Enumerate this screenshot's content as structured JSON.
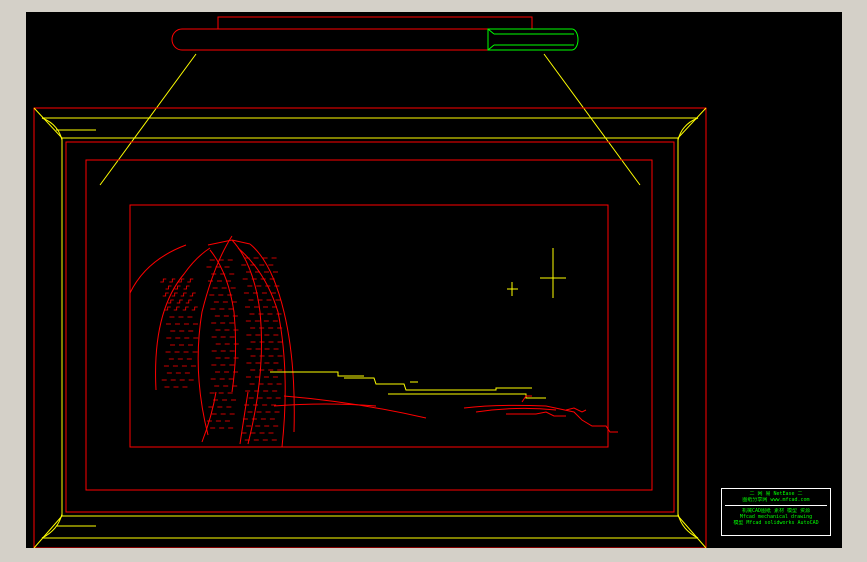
{
  "viewport": {
    "background": "#000000",
    "window_background": "#d4d0c8"
  },
  "colors": {
    "primary_line": "#ff0000",
    "secondary_line": "#ffff00",
    "highlight": "#00ff00",
    "border": "#ffffff"
  },
  "title_block": {
    "line1": "二 网 易  NetEase  二",
    "line2": "图纸分享网    www.mfcad.com",
    "line3": "机械CAD图纸 素材 模型 资源",
    "line4": "Mfcad mechanical drawing",
    "line5": "模型 Mfcad solidworks AutoCAD"
  },
  "crosshair": {
    "visible": true
  }
}
